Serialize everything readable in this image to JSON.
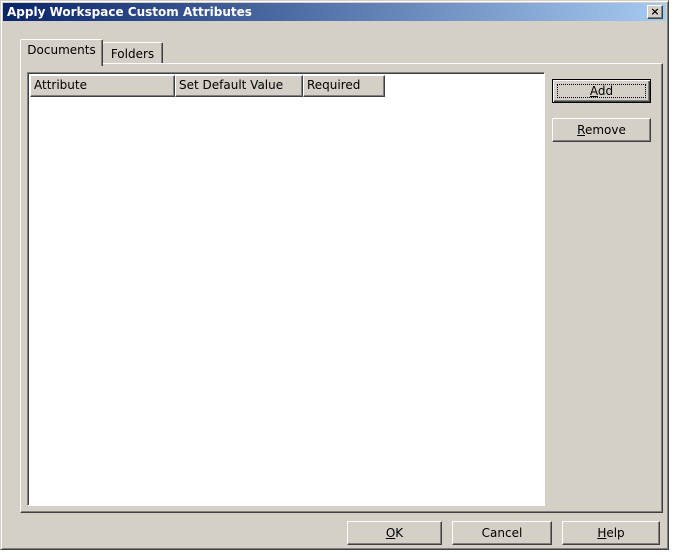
{
  "window": {
    "title": "Apply Workspace Custom Attributes",
    "close_glyph": "×"
  },
  "tabs": [
    {
      "label": "Documents",
      "selected": true
    },
    {
      "label": "Folders",
      "selected": false
    }
  ],
  "listview": {
    "columns": [
      "Attribute",
      "Set Default Value",
      "Required"
    ],
    "rows": []
  },
  "side_buttons": {
    "add": {
      "mnemonic": "A",
      "rest": "dd"
    },
    "remove": {
      "mnemonic": "R",
      "rest": "emove"
    }
  },
  "footer_buttons": {
    "ok": {
      "mnemonic": "O",
      "rest": "K"
    },
    "cancel": {
      "label": "Cancel"
    },
    "help": {
      "mnemonic": "H",
      "rest": "elp"
    }
  },
  "colors": {
    "face": "#d4d0c8",
    "title_start": "#0a246a",
    "title_end": "#a6caf0"
  }
}
